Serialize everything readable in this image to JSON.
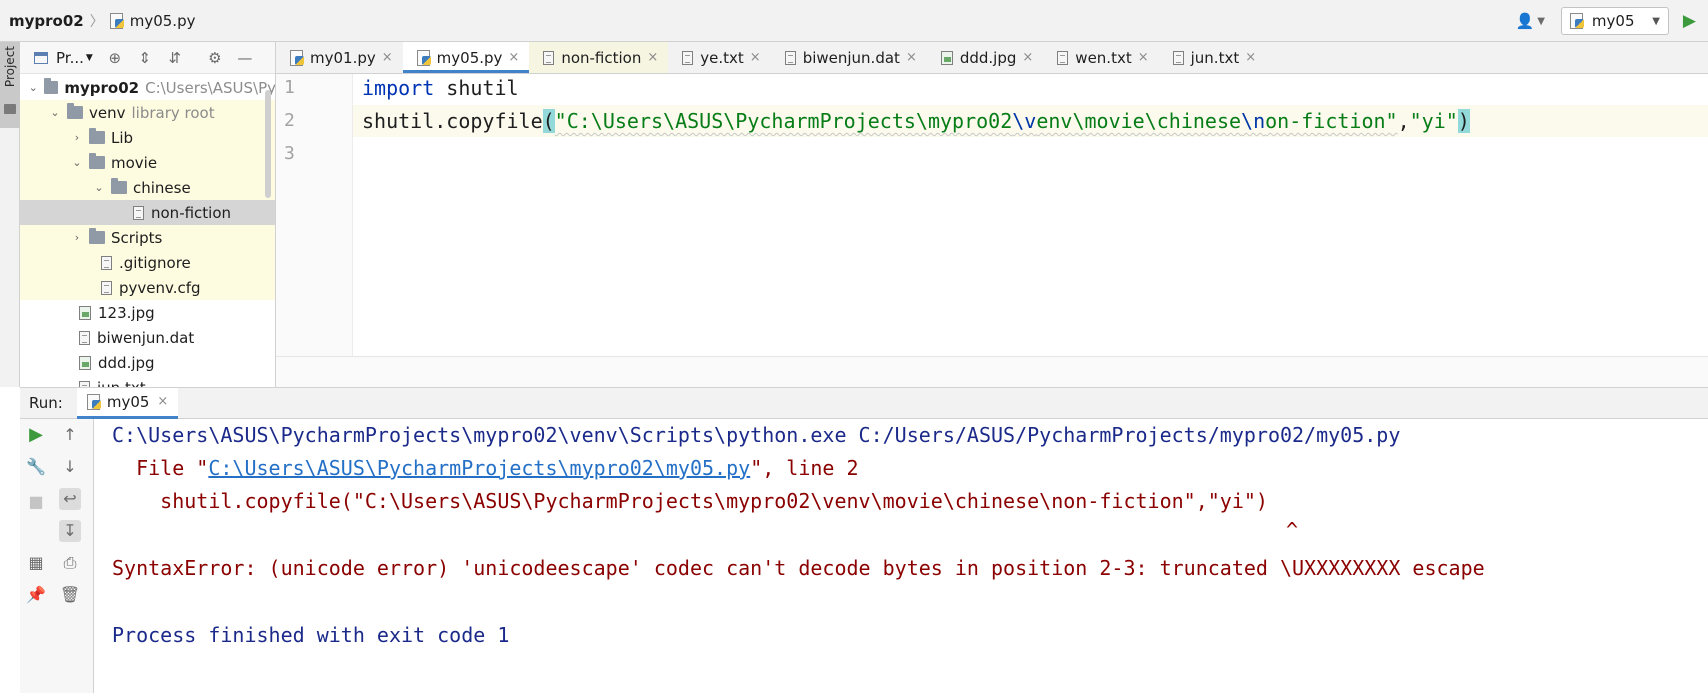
{
  "navbar": {
    "project": "mypro02",
    "file": "my05.py",
    "run_config": "my05"
  },
  "tool_strip": {
    "project_tab": "Project"
  },
  "project_panel": {
    "dropdown_label": "Pr...",
    "tree": [
      {
        "label": "mypro02",
        "hint": "C:\\Users\\ASUS\\Py"
      },
      {
        "label": "venv",
        "hint": "library root"
      },
      {
        "label": "Lib"
      },
      {
        "label": "movie"
      },
      {
        "label": "chinese"
      },
      {
        "label": "non-fiction"
      },
      {
        "label": "Scripts"
      },
      {
        "label": ".gitignore"
      },
      {
        "label": "pyvenv.cfg"
      },
      {
        "label": "123.jpg"
      },
      {
        "label": "biwenjun.dat"
      },
      {
        "label": "ddd.jpg"
      },
      {
        "label": "jun.txt"
      }
    ]
  },
  "editor_tabs": [
    {
      "label": "my01.py"
    },
    {
      "label": "my05.py"
    },
    {
      "label": "non-fiction"
    },
    {
      "label": "ye.txt"
    },
    {
      "label": "biwenjun.dat"
    },
    {
      "label": "ddd.jpg"
    },
    {
      "label": "wen.txt"
    },
    {
      "label": "jun.txt"
    }
  ],
  "editor": {
    "line_numbers": [
      "1",
      "2",
      "3"
    ],
    "line1_keyword": "import",
    "line1_rest": " shutil",
    "line2_call": "shutil.copyfile",
    "line2_open": "(",
    "line2_str_a": "\"C:\\Users\\ASUS\\PycharmProjects\\mypro02",
    "line2_esc_1": "\\v",
    "line2_str_b": "env\\movie\\chinese",
    "line2_esc_2": "\\n",
    "line2_str_c": "on-fiction\"",
    "line2_comma": ",",
    "line2_str_d": "\"yi\"",
    "line2_close": ")"
  },
  "run_panel": {
    "label": "Run:",
    "tab": "my05",
    "console": {
      "cmd": "C:\\Users\\ASUS\\PycharmProjects\\mypro02\\venv\\Scripts\\python.exe C:/Users/ASUS/PycharmProjects/mypro02/my05.py",
      "file_prefix": "  File \"",
      "file_link": "C:\\Users\\ASUS\\PycharmProjects\\mypro02\\my05.py",
      "file_suffix": "\", line 2",
      "code": "    shutil.copyfile(\"C:\\Users\\ASUS\\PycharmProjects\\mypro02\\venv\\movie\\chinese\\non-fiction\",\"yi\")",
      "caret": "^",
      "error": "SyntaxError: (unicode error) 'unicodeescape' codec can't decode bytes in position 2-3: truncated \\UXXXXXXXX escape",
      "exit": "Process finished with exit code 1"
    }
  }
}
